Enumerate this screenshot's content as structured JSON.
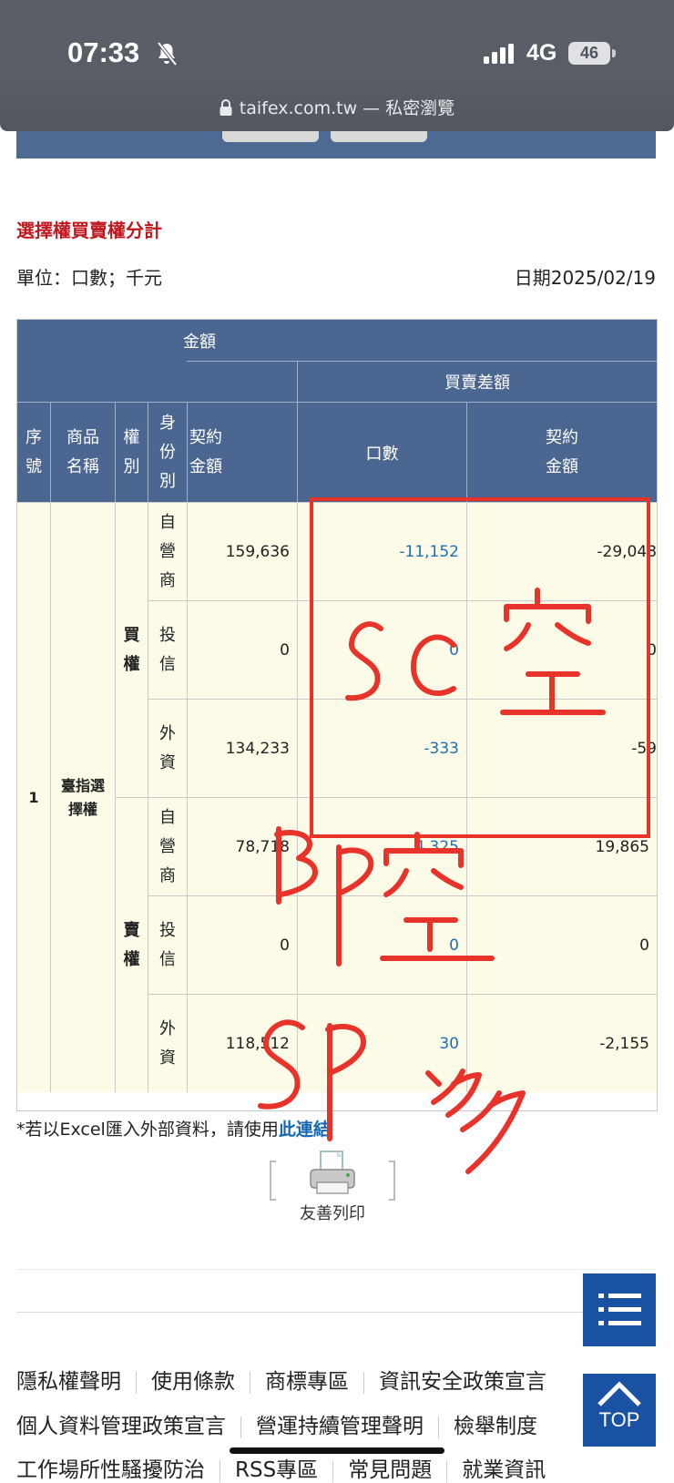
{
  "status_bar": {
    "time": "07:33",
    "network": "4G",
    "battery": "46"
  },
  "browser": {
    "url": "taifex.com.tw — 私密瀏覽"
  },
  "page": {
    "title": "選擇權買賣權分計",
    "unit": "單位：口數；千元",
    "date": "日期2025/02/19"
  },
  "table": {
    "header": {
      "amount_group": "金額",
      "diff_group": "買賣差額",
      "col_seq": "序號",
      "col_product": "商品名稱",
      "col_right": "權別",
      "col_identity": "身份別",
      "col_contract_amount": "契約金額",
      "col_lots": "口數",
      "col_diff_amount": "契約金額"
    },
    "seq": "1",
    "product": "臺指選擇權",
    "call_label": "買權",
    "put_label": "賣權",
    "rows": [
      {
        "identity": "自營商",
        "amount": "159,636",
        "lots": "-11,152",
        "diff_amount": "-29,048"
      },
      {
        "identity": "投信",
        "amount": "0",
        "lots": "0",
        "diff_amount": "0"
      },
      {
        "identity": "外資",
        "amount": "134,233",
        "lots": "-333",
        "diff_amount": "-59"
      },
      {
        "identity": "自營商",
        "amount": "78,718",
        "lots": "4,325",
        "diff_amount": "19,865"
      },
      {
        "identity": "投信",
        "amount": "0",
        "lots": "0",
        "diff_amount": "0"
      },
      {
        "identity": "外資",
        "amount": "118,512",
        "lots": "30",
        "diff_amount": "-2,155"
      }
    ]
  },
  "note": {
    "text": "*若以Excel匯入外部資料，請使用",
    "link": "此連結"
  },
  "print": {
    "label": "友善列印"
  },
  "top_button": {
    "label": "TOP"
  },
  "footer": {
    "row1": [
      "隱私權聲明",
      "使用條款",
      "商標專區",
      "資訊安全政策宣言"
    ],
    "row2": [
      "個人資料管理政策宣言",
      "營運持續管理聲明",
      "檢舉制度"
    ],
    "row3": [
      "工作場所性騷擾防治",
      "RSS專區",
      "常見問題",
      "就業資訊"
    ]
  },
  "annotations": {
    "note1": "SC空",
    "note2": "BP空",
    "note3": "SP多"
  },
  "colors": {
    "header": "#4b6690",
    "body": "#fcfbe8",
    "title": "#c0181e",
    "link": "#1166b5",
    "ink": "#e8332a"
  }
}
